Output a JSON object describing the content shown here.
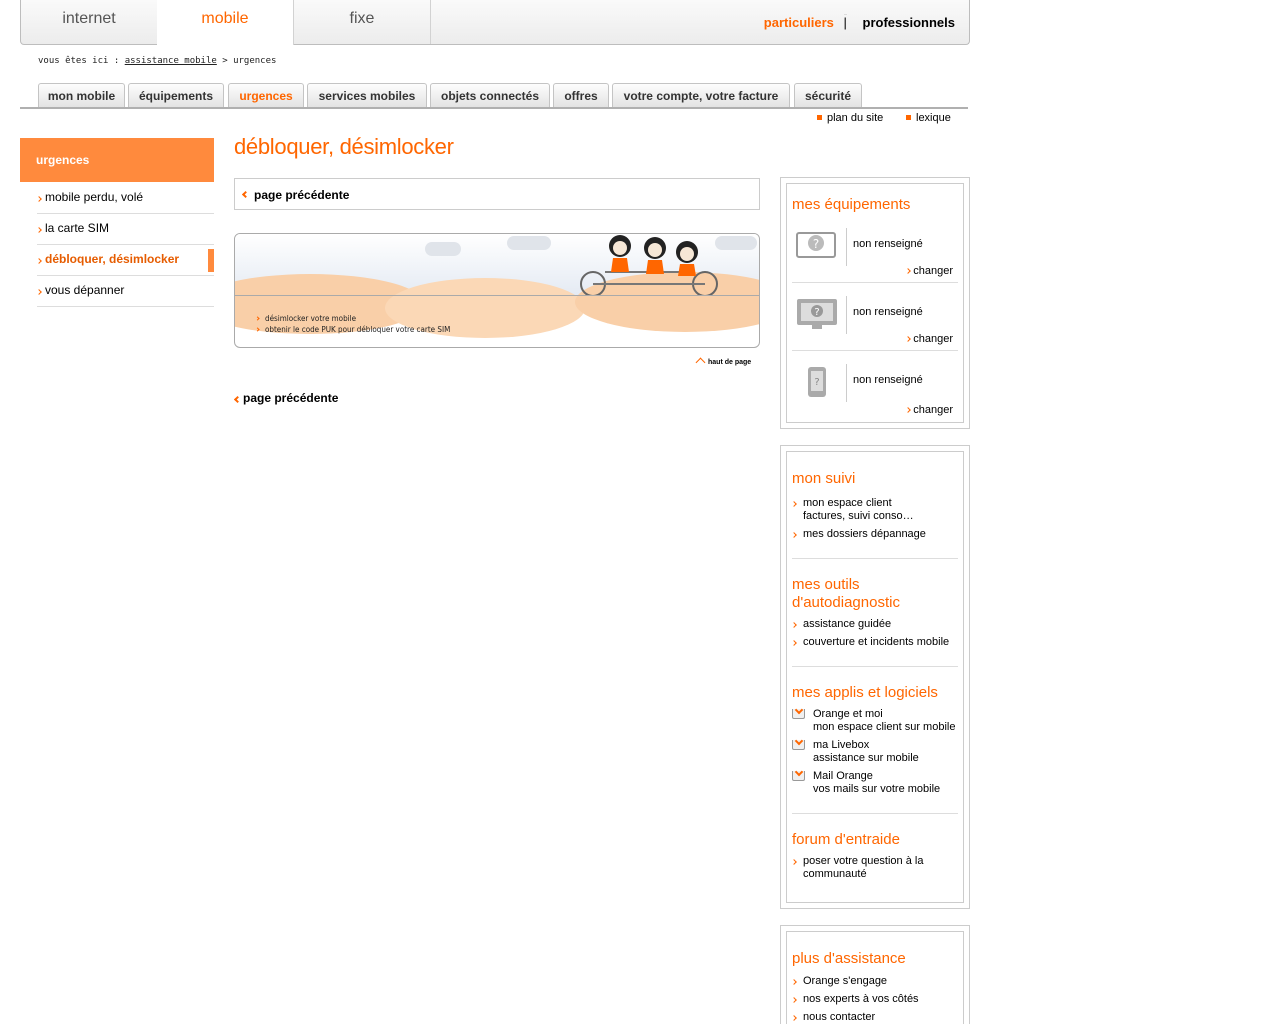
{
  "top_tabs": [
    "internet",
    "mobile",
    "fixe"
  ],
  "segment": {
    "left": "particuliers",
    "separator": "|",
    "right": "professionnels"
  },
  "breadcrumb": {
    "prefix": "vous êtes ici :",
    "link": "assistance mobile",
    "sep": ">",
    "current": "urgences"
  },
  "sub_nav": [
    "mon mobile",
    "équipements",
    "urgences",
    "services mobiles",
    "objets connectés",
    "offres",
    "votre compte, votre facture",
    "sécurité"
  ],
  "utils": [
    "plan du site",
    "lexique"
  ],
  "left_menu": {
    "header": "urgences",
    "items": [
      "mobile perdu, volé",
      "la carte SIM",
      "débloquer, désimlocker",
      "vous dépanner"
    ]
  },
  "main": {
    "title": "débloquer, désimlocker",
    "prev_label": "page précédente",
    "links": [
      "désimlocker votre mobile",
      "obtenir le code PUK pour débloquer votre carte SIM"
    ],
    "top_of_page": "haut de page"
  },
  "equipment": {
    "title": "mes équipements",
    "items": [
      {
        "icon": "unknown-device-icon",
        "status": "non renseigné",
        "action": "changer"
      },
      {
        "icon": "monitor-icon",
        "status": "non renseigné",
        "action": "changer"
      },
      {
        "icon": "mobile-phone-icon",
        "status": "non renseigné",
        "action": "changer"
      }
    ]
  },
  "suivi": {
    "title": "mon suivi",
    "links": [
      {
        "line1": "mon espace client",
        "line2": "factures, suivi conso…"
      },
      {
        "line1": "mes dossiers dépannage"
      }
    ]
  },
  "outils": {
    "title": "mes outils d'autodiagnostic",
    "links": [
      "assistance guidée",
      "couverture et incidents mobile"
    ]
  },
  "applis": {
    "title": "mes applis et logiciels",
    "items": [
      {
        "name": "Orange et moi",
        "desc": "mon espace client sur mobile"
      },
      {
        "name": "ma Livebox",
        "desc": "assistance sur mobile"
      },
      {
        "name": "Mail Orange",
        "desc": "vos mails sur votre mobile"
      }
    ]
  },
  "forum": {
    "title": "forum d'entraide",
    "link": "poser votre question à la communauté"
  },
  "plus": {
    "title": "plus d'assistance",
    "links": [
      "Orange s'engage",
      "nos experts à vos côtés",
      "nous contacter"
    ]
  },
  "colors": {
    "accent": "#ff6600",
    "menu_header": "#ff8a3d"
  }
}
